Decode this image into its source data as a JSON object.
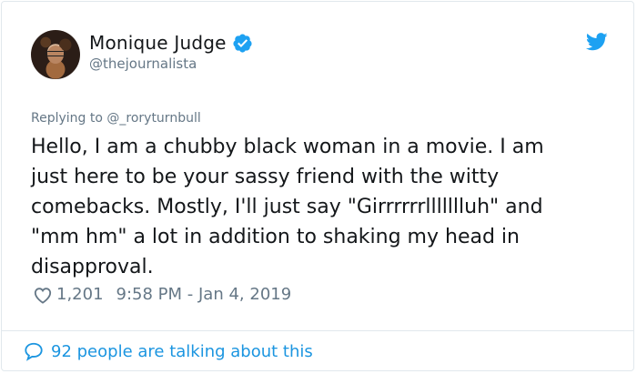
{
  "tweet": {
    "author_name": "Monique Judge",
    "handle": "@thejournalista",
    "reply_prefix": "Replying to",
    "reply_to": "@_roryturnbull",
    "text": "Hello, I am a chubby black woman in a movie. I am\njust here to be your sassy friend with the witty\ncomebacks. Mostly, I'll just say \"Girrrrrrllllllluh\" and\n\"mm hm\" a lot in addition to shaking my head in\ndisapproval.",
    "likes": "1,201",
    "timestamp": "9:58 PM - Jan 4, 2019",
    "conversation": "92 people are talking about this"
  },
  "icons": {
    "verified": "verified-badge-icon",
    "twitter": "twitter-bird-icon",
    "heart": "heart-icon",
    "reply": "chat-bubble-icon"
  },
  "colors": {
    "accent": "#1da1f2",
    "link": "#1b95e0",
    "secondary_text": "#657786",
    "text": "#14171a",
    "border": "#e1e8ed"
  }
}
